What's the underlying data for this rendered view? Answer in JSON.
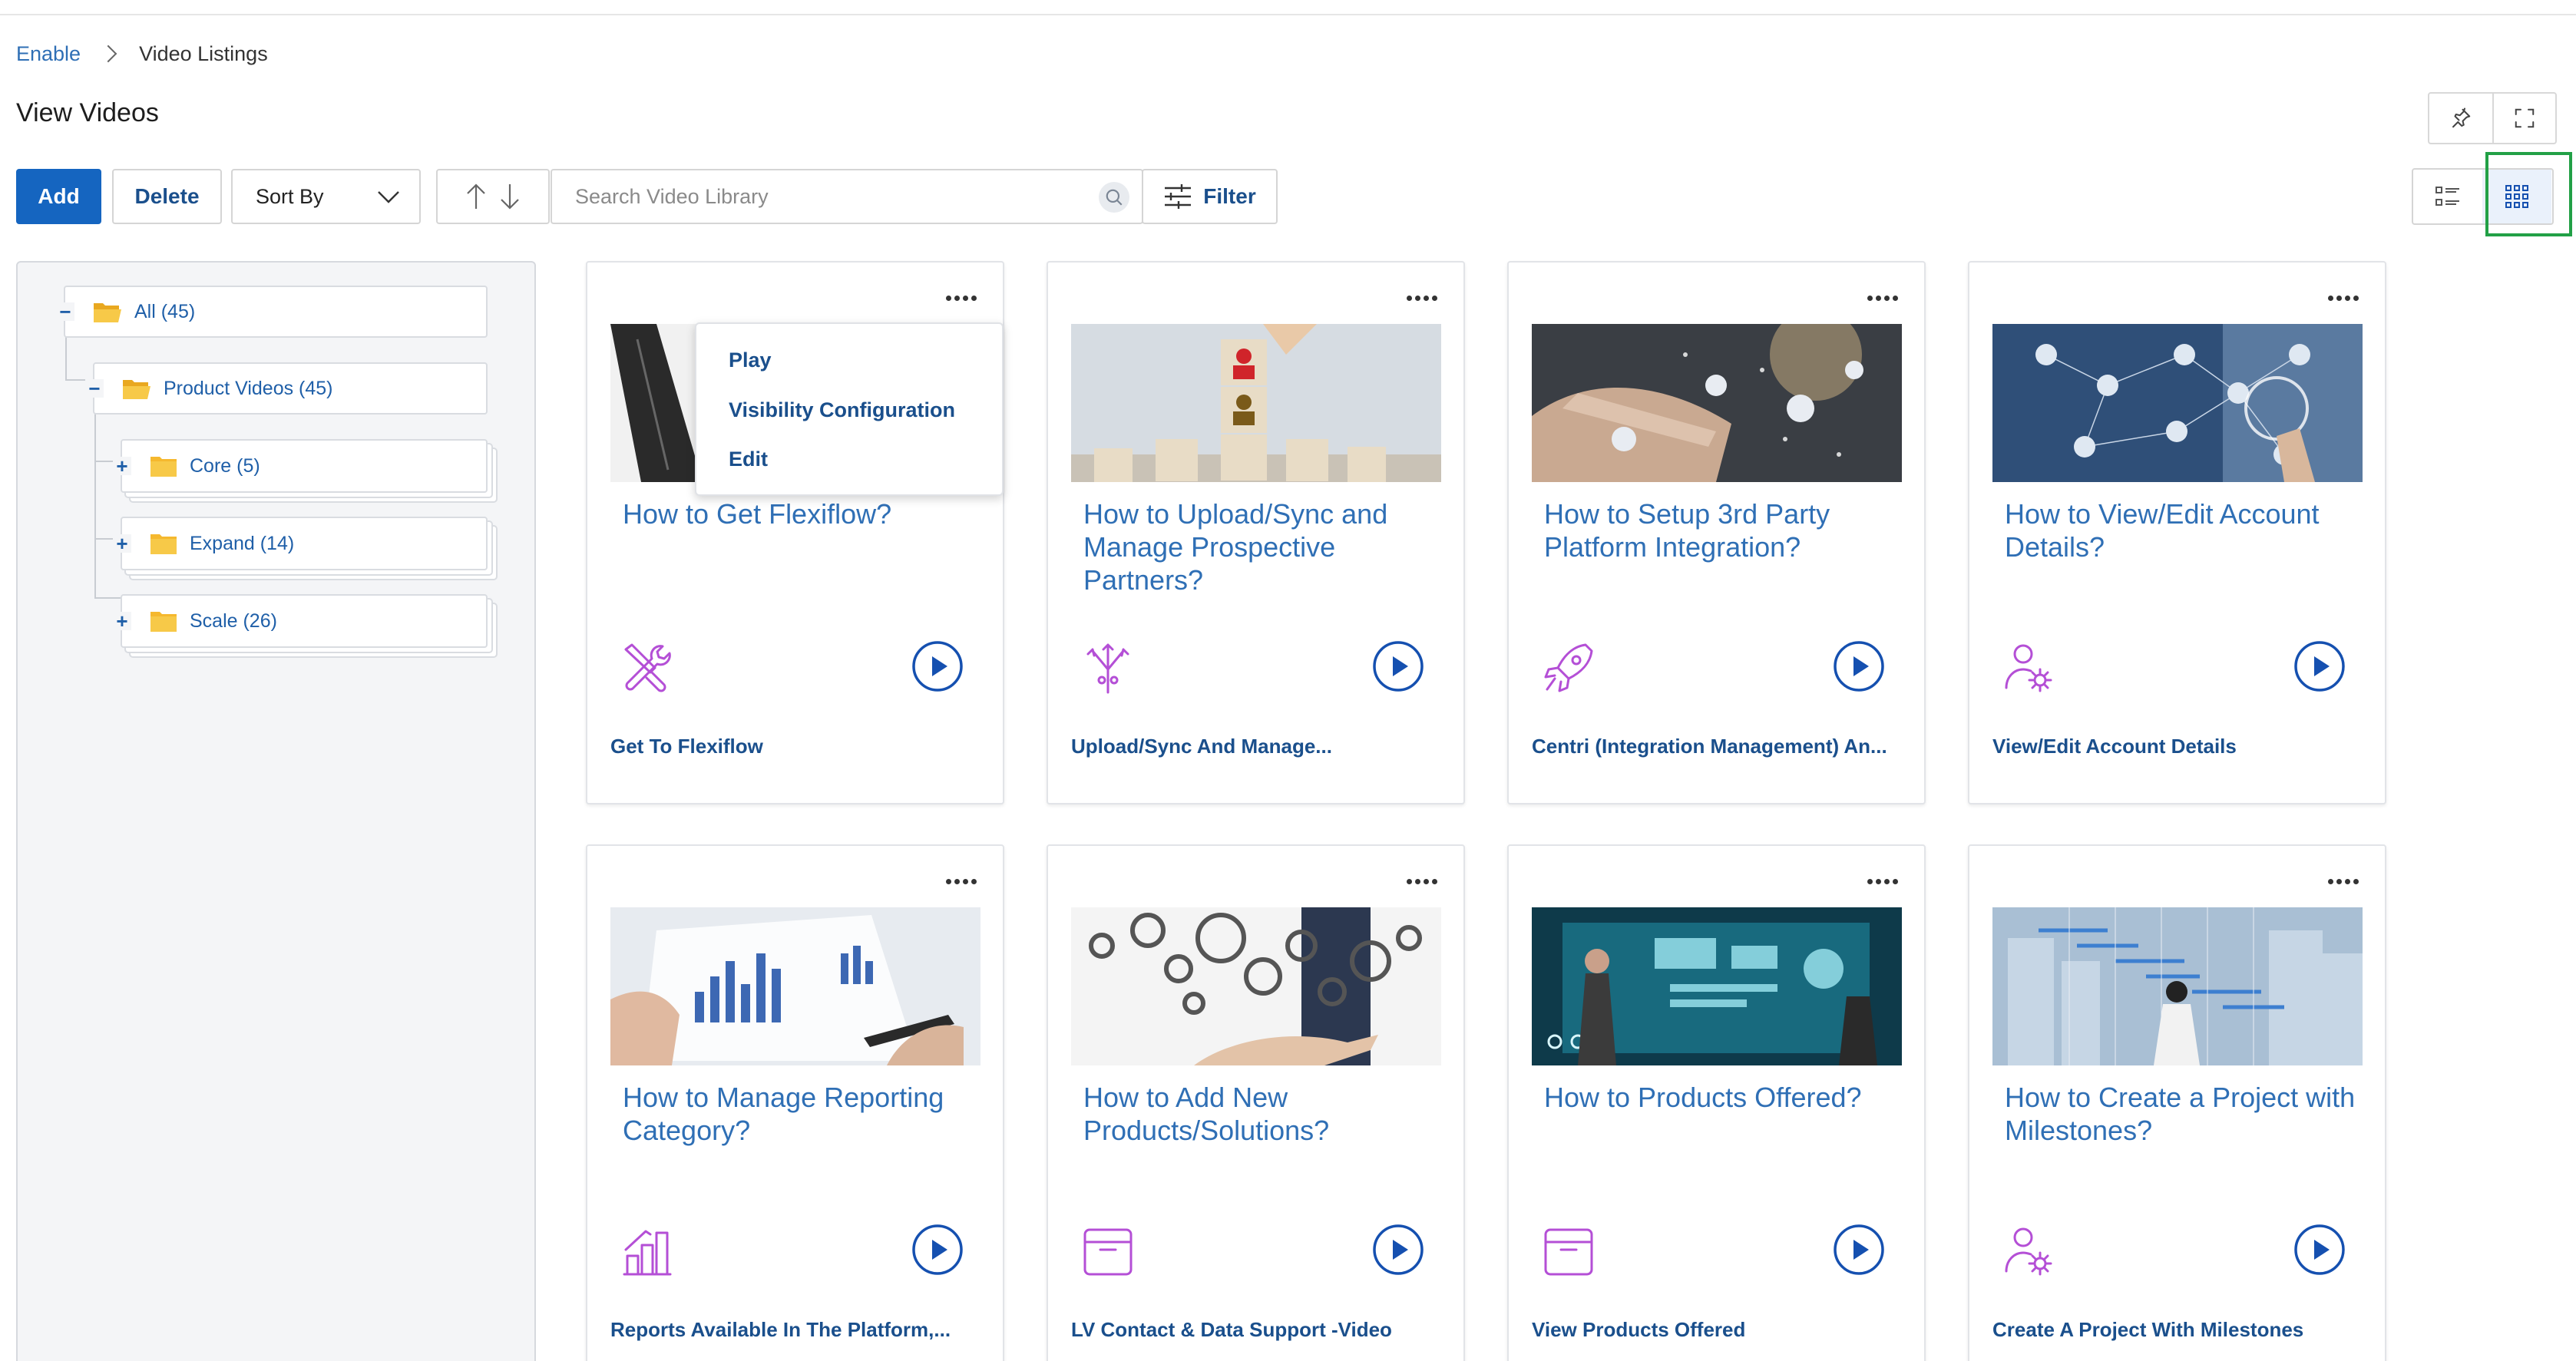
{
  "breadcrumb": {
    "root": "Enable",
    "current": "Video Listings"
  },
  "page": {
    "title": "View Videos"
  },
  "toolbar": {
    "add_label": "Add",
    "delete_label": "Delete",
    "sort_label": "Sort By",
    "search_placeholder": "Search Video Library",
    "filter_label": "Filter"
  },
  "tree": {
    "all": "All (45)",
    "product_videos": "Product Videos (45)",
    "core": "Core (5)",
    "expand": "Expand (14)",
    "scale": "Scale (26)"
  },
  "context_menu": {
    "play": "Play",
    "visibility": "Visibility Configuration",
    "edit": "Edit"
  },
  "cards": [
    {
      "title": "How to Get Flexiflow?",
      "subtitle": "Get To Flexiflow",
      "icon": "tools-icon"
    },
    {
      "title": "How to Upload/Sync and Manage Prospective Partners?",
      "subtitle": "Upload/Sync And Manage...",
      "icon": "fork-arrows-icon"
    },
    {
      "title": "How to Setup 3rd Party Platform Integration?",
      "subtitle": "Centri (Integration Management) An...",
      "icon": "rocket-icon"
    },
    {
      "title": "How to View/Edit Account Details?",
      "subtitle": "View/Edit Account Details",
      "icon": "user-gear-icon"
    },
    {
      "title": "How to Manage Reporting Category?",
      "subtitle": "Reports Available In The Platform,...",
      "icon": "bar-chart-icon"
    },
    {
      "title": "How to Add New Products/Solutions?",
      "subtitle": "LV Contact & Data Support -Video",
      "icon": "archive-box-icon"
    },
    {
      "title": "How to Products Offered?",
      "subtitle": "View Products Offered",
      "icon": "archive-box-icon"
    },
    {
      "title": "How to Create a Project with Milestones?",
      "subtitle": "Create A Project With Milestones",
      "icon": "user-gear-icon"
    }
  ],
  "colors": {
    "primary": "#1565c0",
    "link": "#2f6fb5",
    "icon_purple": "#b44fd6",
    "play_blue": "#1550b0",
    "highlight": "#22a046"
  }
}
